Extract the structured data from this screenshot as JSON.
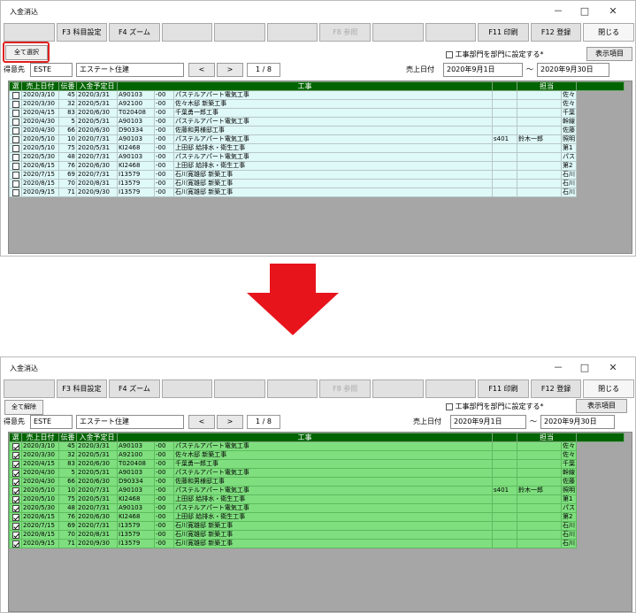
{
  "app": {
    "title": "入金消込"
  },
  "window_controls": {
    "minimize": "－",
    "maximize": "□",
    "close": "✕"
  },
  "fkeys": [
    "",
    "F3 科目設定",
    "F4 ズーム",
    "",
    "",
    "",
    "F8 参照",
    "",
    "",
    "F11 印刷",
    "F12 登録",
    "閉じる"
  ],
  "select_all_label": "全て選択",
  "deselect_all_label": "全て解除",
  "customer": {
    "label": "得意先",
    "code": "ESTE",
    "name": "エステート住建",
    "prev": "<",
    "next": ">",
    "page": "1 / 8"
  },
  "dept_option": {
    "label": "工事部門を部門に設定する*",
    "checked": false
  },
  "display_button": "表示項目",
  "sales_date": {
    "label": "売上日付",
    "from": "2020年9月1日",
    "sep": "～",
    "to": "2020年9月30日"
  },
  "columns": [
    "選",
    "売上日付",
    "伝番",
    "入金予定日",
    "",
    "工事",
    "",
    "担当",
    ""
  ],
  "rows": [
    [
      "2020/3/10",
      "45",
      "2020/3/31",
      "A90103",
      "-00",
      "パステルアパート電気工事",
      "",
      "",
      "",
      "佐々"
    ],
    [
      "2020/3/30",
      "32",
      "2020/5/31",
      "A92100",
      "-00",
      "佐々木邸 新築工事",
      "",
      "",
      "",
      "佐々"
    ],
    [
      "2020/4/15",
      "83",
      "2020/6/30",
      "T020408",
      "-00",
      "千葉勇一郎工事",
      "",
      "",
      "",
      "千葉"
    ],
    [
      "2020/4/30",
      "5",
      "2020/5/31",
      "A90103",
      "-00",
      "パステルアパート電気工事",
      "",
      "",
      "",
      "幹線"
    ],
    [
      "2020/4/30",
      "66",
      "2020/6/30",
      "D90334",
      "-00",
      "佐藤和男様邸工事",
      "",
      "",
      "",
      "佐藤"
    ],
    [
      "2020/5/10",
      "10",
      "2020/7/31",
      "A90103",
      "-00",
      "パステルアパート電気工事",
      "s401",
      "鈴木一郎",
      "",
      "照明"
    ],
    [
      "2020/5/10",
      "75",
      "2020/5/31",
      "KI2468",
      "-00",
      "上田邸 給排水・衛生工事",
      "",
      "",
      "",
      "第1"
    ],
    [
      "2020/5/30",
      "48",
      "2020/7/31",
      "A90103",
      "-00",
      "パステルアパート電気工事",
      "",
      "",
      "",
      "パス"
    ],
    [
      "2020/6/15",
      "76",
      "2020/6/30",
      "KI2468",
      "-00",
      "上田邸 給排水・衛生工事",
      "",
      "",
      "",
      "第2"
    ],
    [
      "2020/7/15",
      "69",
      "2020/7/31",
      "I13579",
      "-00",
      "石川寛雄邸 新築工事",
      "",
      "",
      "",
      "石川"
    ],
    [
      "2020/8/15",
      "70",
      "2020/8/31",
      "I13579",
      "-00",
      "石川寛雄邸 新築工事",
      "",
      "",
      "",
      "石川"
    ],
    [
      "2020/9/15",
      "71",
      "2020/9/30",
      "I13579",
      "-00",
      "石川寛雄邸 新築工事",
      "",
      "",
      "",
      "石川"
    ]
  ],
  "colors": {
    "header_green": "#006400",
    "row_unselected": "#dff8f8",
    "row_selected": "#7fdf7f",
    "arrow_red": "#e8141c",
    "highlight_outline": "#e02020"
  },
  "icons": {
    "arrow": "down-arrow-icon"
  }
}
